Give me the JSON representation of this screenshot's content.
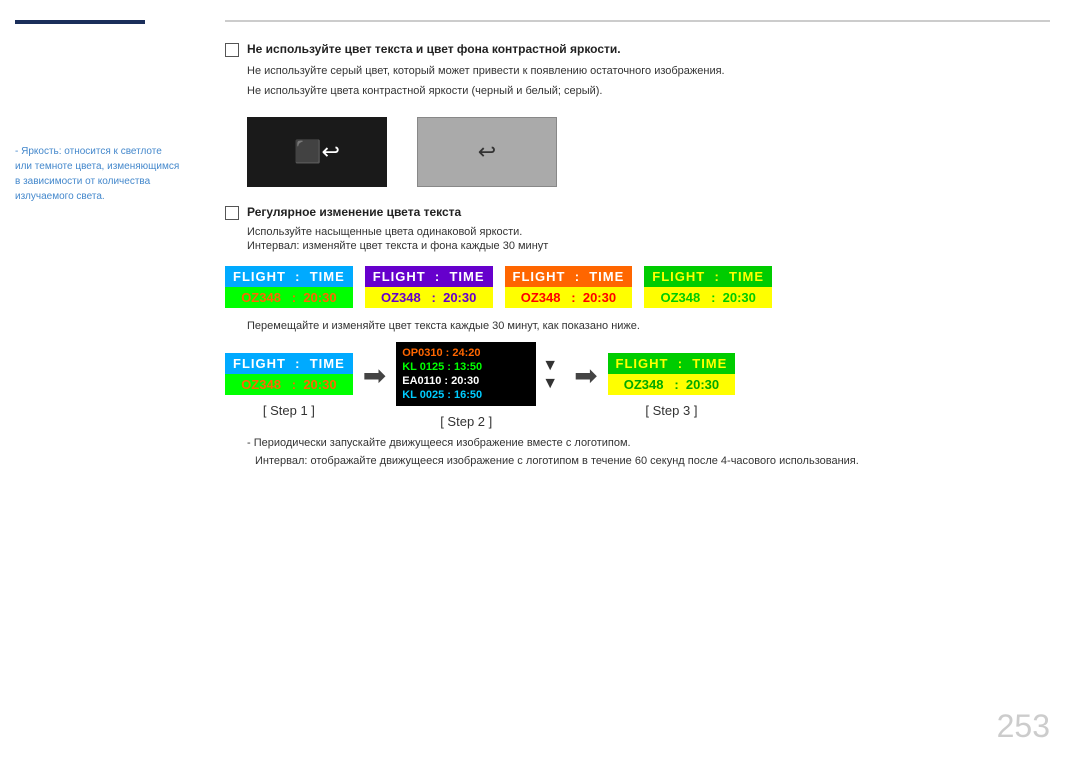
{
  "sidebar": {
    "note": "- Яркость: относится к светлоте или темноте цвета, изменяющимся в зависимости от количества излучаемого света."
  },
  "rules": {
    "rule1": {
      "label": "Не используйте цвет текста и цвет фона контрастной яркости.",
      "sub1": "Не используйте серый цвет, который может привести к появлению остаточного изображения.",
      "sub2": "Не используйте цвета контрастной яркости (черный и белый; серый)."
    },
    "rule2": {
      "label": "Регулярное изменение цвета текста",
      "dash1": "Используйте насыщенные цвета одинаковой яркости.",
      "dash2": "Интервал: изменяйте цвет текста и фона каждые 30 минут"
    }
  },
  "flight_variants": [
    {
      "top": "FLIGHT  :  TIME",
      "bottom": "OZ348   :  20:30",
      "top_bg": "#00aaff",
      "top_color": "#ffffff",
      "bot_bg": "#00ff00",
      "bot_color": "#ff6600"
    },
    {
      "top": "FLIGHT  :  TIME",
      "bottom": "OZ348   :  20:30",
      "top_bg": "#6600cc",
      "top_color": "#ffffff",
      "bot_bg": "#ffff00",
      "bot_color": "#6600cc"
    },
    {
      "top": "FLIGHT  :  TIME",
      "bottom": "OZ348   :  20:30",
      "top_bg": "#ff6600",
      "top_color": "#ffffff",
      "bot_bg": "#ffff00",
      "bot_color": "#ff0000"
    },
    {
      "top": "FLIGHT  :  TIME",
      "bottom": "OZ348   :  20:30",
      "top_bg": "#00cc00",
      "top_color": "#ffff00",
      "bot_bg": "#ffff00",
      "bot_color": "#00aa00"
    }
  ],
  "steps": {
    "step1": {
      "label": "[ Step 1 ]",
      "flight_top": "FLIGHT  :  TIME",
      "flight_bottom": "OZ348   :  20:30"
    },
    "step2": {
      "label": "[ Step 2 ]",
      "rows": [
        {
          "text": "OP0310 :  24:20",
          "color": "#ff6600"
        },
        {
          "text": "KL 0125 :  13:50",
          "color": "#00ff00"
        },
        {
          "text": "EA0110 :  20:30",
          "color": "#ffffff"
        },
        {
          "text": "KL 0025 :  16:50",
          "color": "#00ccff"
        }
      ]
    },
    "step3": {
      "label": "[ Step 3 ]",
      "flight_top": "FLIGHT  :  TIME",
      "flight_bottom": "OZ348   :  20:30"
    }
  },
  "move_note": {
    "dash": "Перемещайте и изменяйте цвет текста каждые 30 минут, как показано ниже."
  },
  "bottom_notes": {
    "note1": "- Периодически запускайте движущееся изображение вместе с логотипом.",
    "note2": "Интервал: отображайте движущееся изображение с логотипом в течение 60 секунд после 4-часового использования."
  },
  "page_number": "253"
}
